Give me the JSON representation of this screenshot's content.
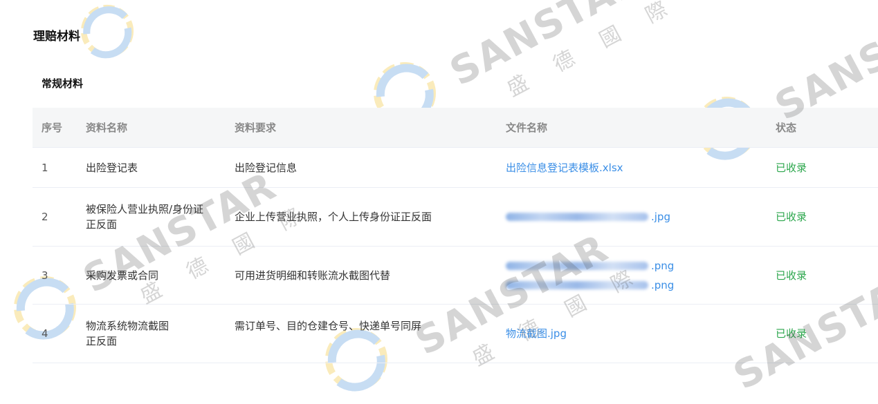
{
  "section_title": "理赔材料",
  "sub_title": "常规材料",
  "table": {
    "headers": [
      "序号",
      "资料名称",
      "资料要求",
      "文件名称",
      "状态"
    ],
    "rows": [
      {
        "seq": "1",
        "name_line1": "出险登记表",
        "name_line2": "",
        "requirement_line1": "出险登记信息",
        "requirement_line2": "",
        "files": [
          ".xlsx"
        ],
        "file_text": "出险信息登记表模板.xlsx",
        "status": "已收录"
      },
      {
        "seq": "2",
        "name_line1": "被保险人营业执照/身份证",
        "name_line2": "正反面",
        "requirement_line1": "企业上传营业执照，个人上传身份证正反面",
        "requirement_line2": "",
        "file_ext_1": ".jpg",
        "status": "已收录"
      },
      {
        "seq": "3",
        "name_line1": "采购发票或合同",
        "name_line2": "",
        "requirement_line1": "可用进货明细和转账流水截图代替",
        "requirement_line2": "",
        "file_ext_1": ".png",
        "file_ext_2": ".png",
        "status": "已收录"
      },
      {
        "seq": "4",
        "name_line1": "物流系统物流截图",
        "name_line2": "正反面",
        "requirement_line1": "需订单号、目的仓建仓号、快递单号同屏",
        "requirement_line2": "",
        "file_text": "物流截图.jpg",
        "status": "已收录"
      }
    ]
  },
  "watermark": {
    "brand": "SANSTAR",
    "cn": "盛 德 國 際"
  },
  "colors": {
    "link": "#3a8ee6",
    "status": "#2aa64b",
    "header_bg": "#f5f6f7"
  }
}
